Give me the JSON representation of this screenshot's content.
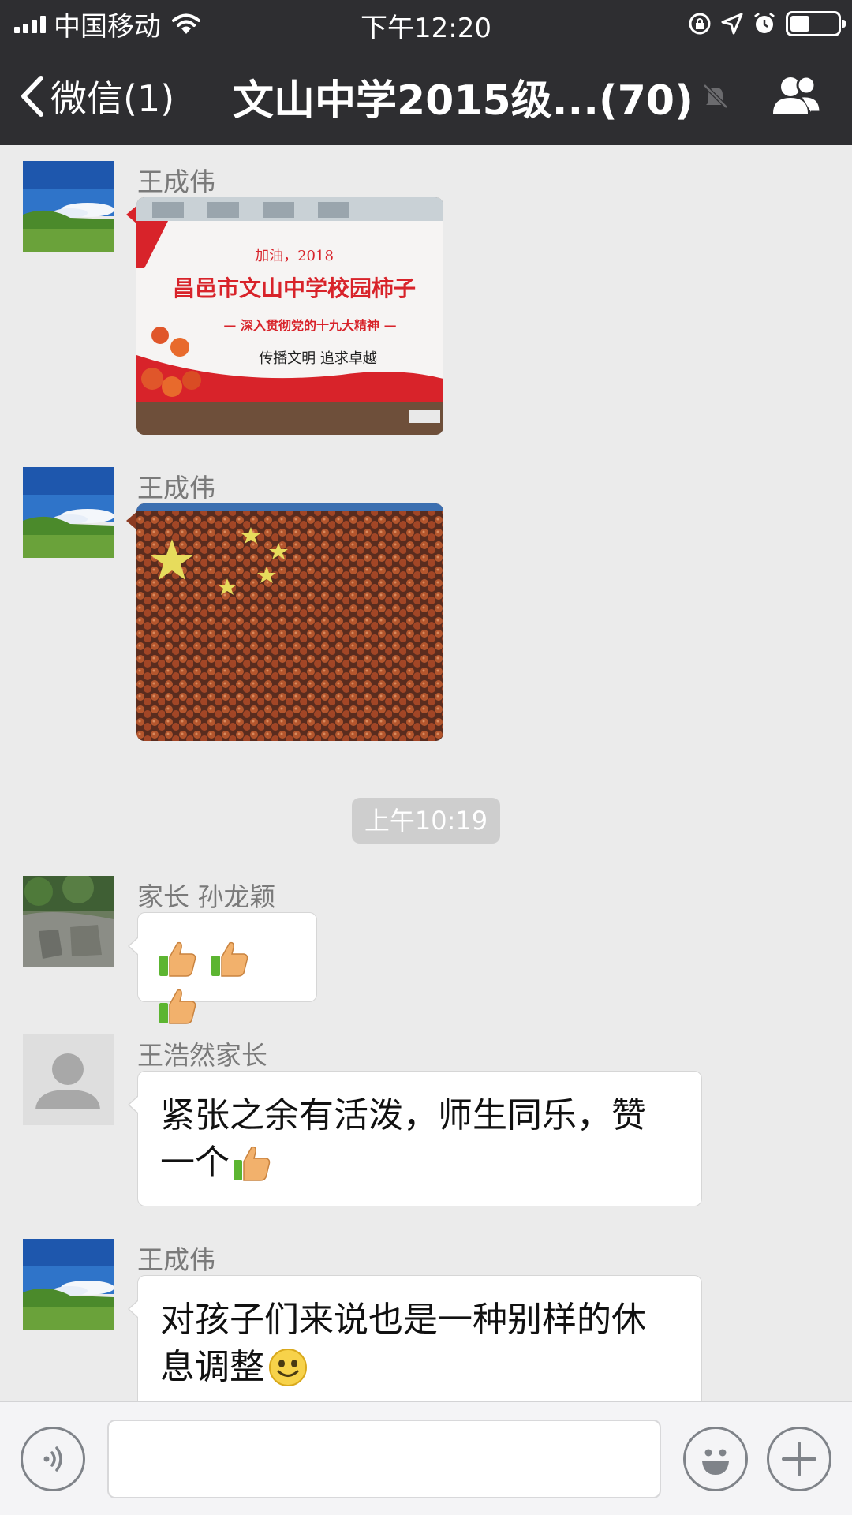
{
  "status_bar": {
    "carrier": "中国移动",
    "time": "下午12:20"
  },
  "nav": {
    "back_label": "微信(1)",
    "title": "文山中学2015级...(70)"
  },
  "messages": [
    {
      "type": "image",
      "sender": "王成伟",
      "image_desc": "banner-photo",
      "banner_lines": [
        "加油，2018",
        "昌邑市文山中学校园柿子",
        "— 深入贯彻党的十九大精神 —",
        "传播文明   追求卓越"
      ]
    },
    {
      "type": "image",
      "sender": "王成伟",
      "image_desc": "persimmons-flag-photo"
    },
    {
      "type": "timestamp",
      "text": "上午10:19"
    },
    {
      "type": "text",
      "sender": "家长 孙龙颖",
      "text": "",
      "emoji": [
        "thumbs-up",
        "thumbs-up",
        "thumbs-up"
      ]
    },
    {
      "type": "text",
      "sender": "王浩然家长",
      "line1": "紧张之余有活泼，师生同乐，赞",
      "line2": "一个",
      "emoji": [
        "thumbs-up"
      ]
    },
    {
      "type": "text",
      "sender": "王成伟",
      "line1": "对孩子们来说也是一种别样的休",
      "line2": "息调整",
      "emoji": [
        "smile"
      ]
    }
  ],
  "icons": {
    "back": "chevron-left-icon",
    "mute": "bell-slash-icon",
    "group": "group-members-icon",
    "voice": "voice-icon",
    "emoji": "emoji-icon",
    "more": "plus-icon"
  },
  "colors": {
    "header_bg": "#2e2e31",
    "chat_bg": "#ebebeb",
    "bubble_bg": "#ffffff",
    "timestamp_bg": "#cecece"
  }
}
